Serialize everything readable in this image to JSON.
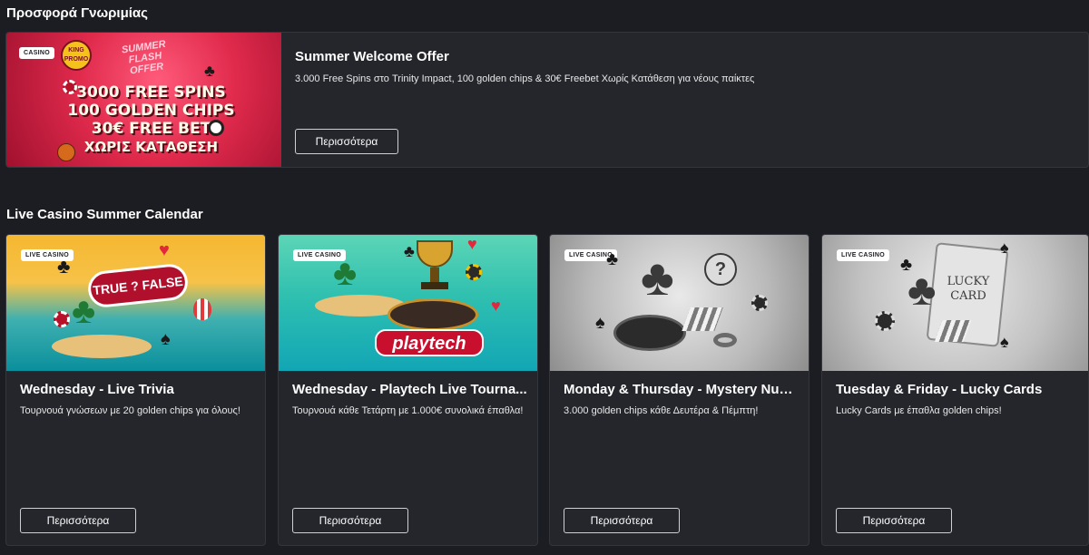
{
  "welcome": {
    "section_title": "Προσφορά Γνωριμίας",
    "badge": "CASINO",
    "logo_text": "KING PROMO",
    "promo_tag": "SUMMER FLASH OFFER",
    "promo_lines": [
      "3000 FREE SPINS",
      "100 GOLDEN CHIPS",
      "30€ FREE BET",
      "ΧΩΡΙΣ ΚΑΤΑΘΕΣΗ"
    ],
    "title": "Summer Welcome Offer",
    "description": "3.000 Free Spins στο Trinity Impact, 100 golden chips & 30€ Freebet Χωρίς Κατάθεση για νέους παίκτες",
    "button_label": "Περισσότερα"
  },
  "calendar": {
    "section_title": "Live Casino Summer Calendar",
    "badge": "LIVE CASINO",
    "cards": [
      {
        "title": "Wednesday - Live Trivia",
        "description": "Τουρνουά γνώσεων με 20 golden chips για όλους!",
        "button_label": "Περισσότερα",
        "art_text": "TRUE ? FALSE"
      },
      {
        "title": "Wednesday - Playtech Live Tourna...",
        "description": "Τουρνουά κάθε Τετάρτη με 1.000€ συνολικά έπαθλα!",
        "button_label": "Περισσότερα",
        "art_text": "playtech"
      },
      {
        "title": "Monday & Thursday - Mystery Num...",
        "description": "3.000 golden chips κάθε Δευτέρα & Πέμπτη!",
        "button_label": "Περισσότερα",
        "art_text": "?"
      },
      {
        "title": "Tuesday & Friday - Lucky Cards",
        "description": "Lucky Cards με έπαθλα golden chips!",
        "button_label": "Περισσότερα",
        "art_text": "LUCKY CARD"
      }
    ]
  }
}
